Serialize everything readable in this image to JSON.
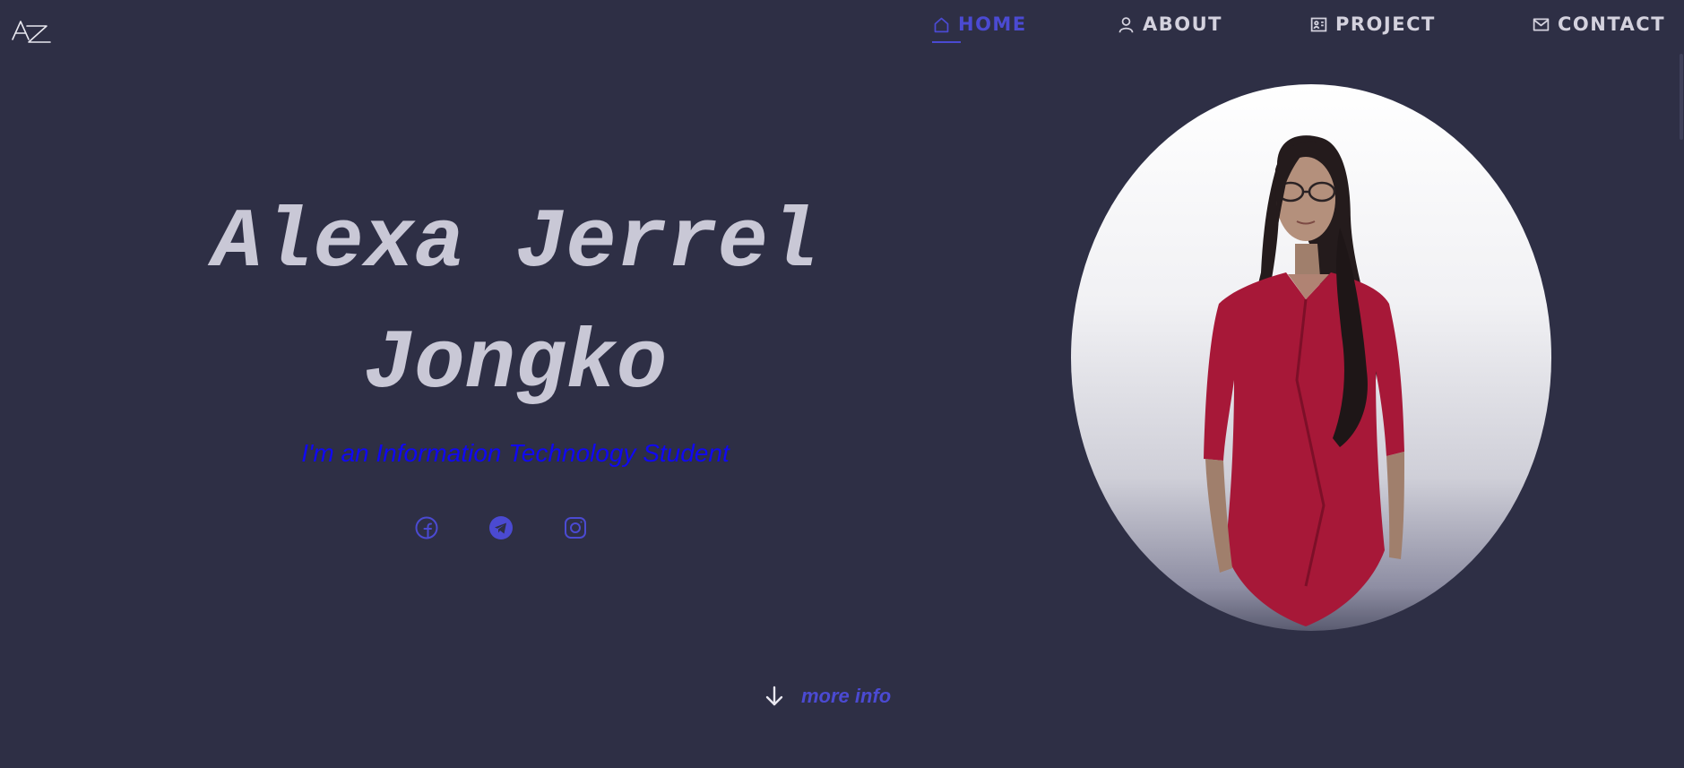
{
  "logo": {
    "text": "AZ",
    "icon": "az-logo-icon"
  },
  "nav": {
    "items": [
      {
        "label": "HOME",
        "icon": "home-icon",
        "active": true
      },
      {
        "label": "ABOUT",
        "icon": "user-icon",
        "active": false
      },
      {
        "label": "PROJECT",
        "icon": "folder-image-icon",
        "active": false
      },
      {
        "label": "CONTACT",
        "icon": "mail-icon",
        "active": false
      }
    ]
  },
  "hero": {
    "name_line1": "Alexa Jerrel",
    "name_line2": "Jongko",
    "tagline": "I'm an Information Technology Student",
    "social": [
      {
        "name": "facebook",
        "icon": "facebook-icon"
      },
      {
        "name": "telegram",
        "icon": "telegram-icon"
      },
      {
        "name": "instagram",
        "icon": "instagram-icon"
      }
    ]
  },
  "more_info": {
    "label": "more info",
    "icon": "arrow-down-icon"
  },
  "colors": {
    "background": "#2e2f45",
    "accent": "#4b4ad2",
    "nav_text": "#d4d2de",
    "name_text": "#c9c8d6",
    "tagline": "#1008f2"
  }
}
